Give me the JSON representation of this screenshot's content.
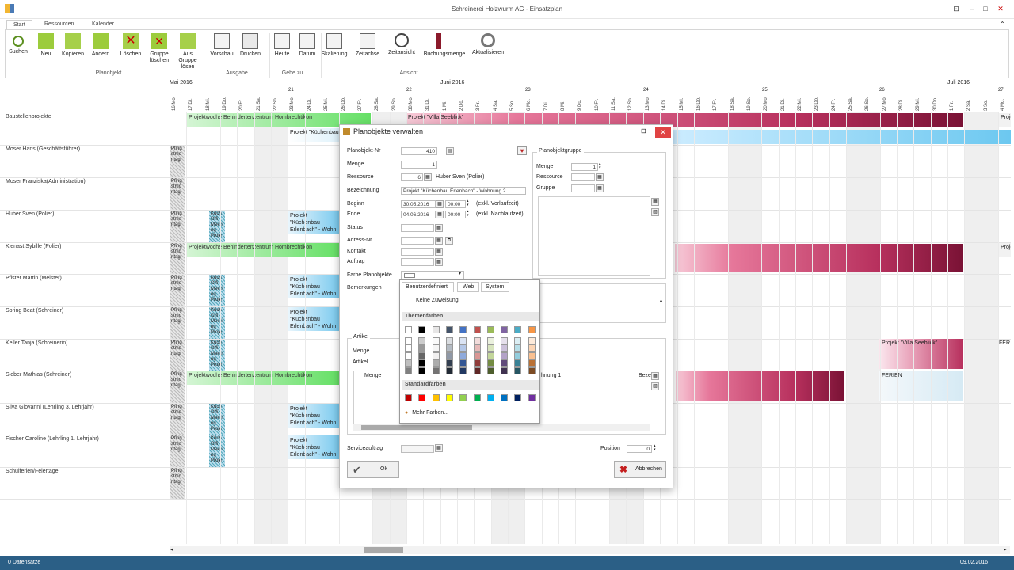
{
  "window": {
    "title": "Schreinerei Holzwurm AG - Einsatzplan"
  },
  "tabs": [
    "Start",
    "Ressourcen",
    "Kalender"
  ],
  "ribbon": {
    "buttons": [
      {
        "label": "Suchen",
        "icon": "search-icon"
      },
      {
        "label": "Neu",
        "icon": "new-icon"
      },
      {
        "label": "Kopieren",
        "icon": "copy-icon"
      },
      {
        "label": "Ändern",
        "icon": "edit-icon"
      },
      {
        "label": "Löschen",
        "icon": "delete-icon"
      },
      {
        "label": "Gruppe löschen",
        "icon": "group-delete-icon"
      },
      {
        "label": "Aus Gruppe lösen",
        "icon": "ungroup-icon"
      },
      {
        "label": "Vorschau",
        "icon": "preview-icon"
      },
      {
        "label": "Drucken",
        "icon": "print-icon"
      },
      {
        "label": "Heute",
        "icon": "today-icon"
      },
      {
        "label": "Datum",
        "icon": "date-icon"
      },
      {
        "label": "Skalierung",
        "icon": "scale-icon"
      },
      {
        "label": "Zeitachse",
        "icon": "timeline-icon"
      },
      {
        "label": "Zeitansicht",
        "icon": "clock-icon"
      },
      {
        "label": "Buchungsmenge",
        "icon": "booking-icon"
      },
      {
        "label": "Aktualisieren",
        "icon": "refresh-icon"
      }
    ],
    "groups": [
      "Planobjekt",
      "Ausgabe",
      "Gehe zu",
      "Ansicht"
    ]
  },
  "months": [
    "Mai 2016",
    "Juni 2016",
    "Juli 2016"
  ],
  "weeks": [
    "21",
    "22",
    "23",
    "24",
    "25",
    "26",
    "27"
  ],
  "days": [
    "16 Mo.",
    "17 Di.",
    "18 Mi.",
    "19 Do.",
    "20 Fr.",
    "21 Sa.",
    "22 So.",
    "23 Mo.",
    "24 Di.",
    "25 Mi.",
    "26 Do.",
    "27 Fr.",
    "28 Sa.",
    "29 So.",
    "30 Mo.",
    "31 Di.",
    "1 Mi.",
    "2 Do.",
    "3 Fr.",
    "4 Sa.",
    "5 So.",
    "6 Mo.",
    "7 Di.",
    "8 Mi.",
    "9 Do.",
    "10 Fr.",
    "11 Sa.",
    "12 So.",
    "13 Mo.",
    "14 Di.",
    "15 Mi.",
    "16 Do.",
    "17 Fr.",
    "18 Sa.",
    "19 So.",
    "20 Mo.",
    "21 Di.",
    "22 Mi.",
    "23 Do.",
    "24 Fr.",
    "25 Sa.",
    "26 So.",
    "27 Mo.",
    "28 Di.",
    "29 Mi.",
    "30 Do.",
    "1 Fr.",
    "2 Sa.",
    "3 So.",
    "4 Mo."
  ],
  "rows": [
    "Baustellenprojekte",
    "Moser Hans (Geschäftsführer)",
    "Moser Franziska(Administration)",
    "Huber Sven (Polier)",
    "Kienast Sybille (Polier)",
    "Pfister Martin (Meister)",
    "Spring Beat (Schreiner)",
    "Keller Tanja (Schreinerin)",
    "Sieber Mathias (Schreiner)",
    "Silva Giovanni (Lehrling 3. Lehrjahr)",
    "Fischer Caroline (Lehrling 1. Lehrjahr)",
    "Schulferien/Feiertage"
  ],
  "bars": {
    "behinderten": "Projektwoche Behindertenzentrum Hombrechtikon",
    "kuechen1": "Projekt \"Küchenbau",
    "kuechen_line1": "Projekt \"Küchenbau",
    "kuechen_line2": "Erlenbach\" - Wohn",
    "villa": "Projekt \"Villa Seeblick\"",
    "villa2": "Projekt \"Villa Seeblick\"",
    "ferien": "FERIEN",
    "fer": "FER",
    "pfingst": "Pfing stmo ntag",
    "kueche_short": "Küch Offi Meeti ng Proje",
    "proj": "Proje"
  },
  "dialog": {
    "title": "Planobjekte verwalten",
    "fields": {
      "planobjekt_nr_label": "Planobjekt-Nr",
      "planobjekt_nr": "410",
      "menge_label": "Menge",
      "menge": "1",
      "ressource_label": "Ressource",
      "ressource": "6",
      "ressource_name": "Huber Sven (Polier)",
      "bezeichnung_label": "Bezeichnung",
      "bezeichnung": "Projekt \"Küchenbau Erlenbach\" - Wohnung 2",
      "beginn_label": "Beginn",
      "beginn_date": "30.05.2016",
      "beginn_time": "00:00",
      "beginn_note": "(exkl. Vorlaufzeit)",
      "ende_label": "Ende",
      "ende_date": "04.06.2016",
      "ende_time": "00:00",
      "ende_note": "(exkl. Nachlaufzeit)",
      "status_label": "Status",
      "adress_label": "Adress-Nr.",
      "kontakt_label": "Kontakt",
      "auftrag_label": "Auftrag",
      "farbe_label": "Farbe Planobjekte",
      "bemerkungen_label": "Bemerkungen",
      "artikel_group": "Artikel",
      "artikel_menge_label": "Menge",
      "artikel_label": "Artikel",
      "col_menge": "Menge",
      "col_bez_partial": "hnung 1",
      "col_bez": "Beze",
      "serviceauftrag_label": "Serviceauftrag",
      "position_label": "Position",
      "position": "0"
    },
    "group": {
      "title": "Planobjektgruppe",
      "menge_label": "Menge",
      "menge": "1",
      "ressource_label": "Ressource",
      "gruppe_label": "Gruppe"
    },
    "ok": "Ok",
    "cancel": "Abbrechen"
  },
  "color_picker": {
    "tabs": [
      "Benutzerdefiniert",
      "Web",
      "System"
    ],
    "none": "Keine Zuweisung",
    "theme_title": "Themenfarben",
    "standard_title": "Standardfarben",
    "more": "Mehr Farben...",
    "theme_top": [
      "#ffffff",
      "#000000",
      "#e7e6e6",
      "#44546a",
      "#4472c4",
      "#c0504d",
      "#9bbb59",
      "#8064a2",
      "#4bacc6",
      "#f79646"
    ],
    "standard": [
      "#c00000",
      "#ff0000",
      "#ffc000",
      "#ffff00",
      "#92d050",
      "#00b050",
      "#00b0f0",
      "#0070c0",
      "#002060",
      "#7030a0"
    ]
  },
  "status": {
    "records": "0 Datensätze",
    "date": "09.02.2016"
  }
}
